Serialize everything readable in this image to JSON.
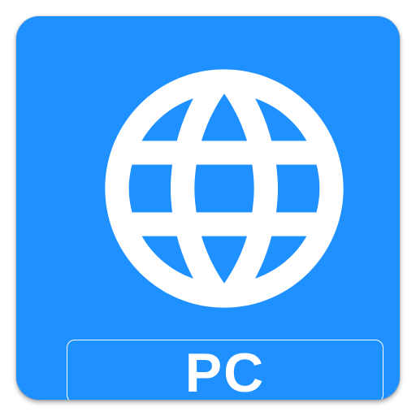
{
  "app_icon": {
    "label": "PC",
    "icon": "globe-icon",
    "colors": {
      "background": "#1e90ff",
      "foreground": "#ffffff"
    }
  }
}
